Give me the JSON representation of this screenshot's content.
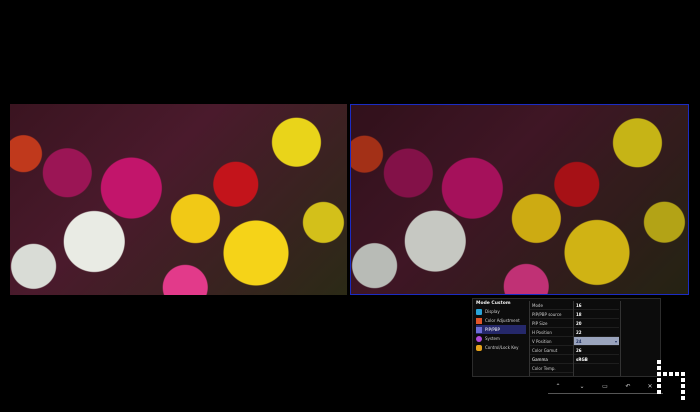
{
  "osd": {
    "title": "Mode Custom",
    "menu": [
      {
        "label": "Display",
        "icon": "display-icon",
        "color": "#2aa3d8"
      },
      {
        "label": "Color Adjustment",
        "icon": "color-adjustment-icon",
        "color": "#e0552a"
      },
      {
        "label": "PIP/PBP",
        "icon": "pip-pbp-icon",
        "color": "#6b6cd6"
      },
      {
        "label": "System",
        "icon": "system-icon",
        "color": "#b04bd8"
      },
      {
        "label": "Control/Lock Key",
        "icon": "lock-key-icon",
        "color": "#e6a21a"
      }
    ],
    "selected_menu": 2,
    "settings": [
      "Mode",
      "PIP/PBP source",
      "PIP Size",
      "H Position",
      "V Position",
      "Color Gamut",
      "Gamma",
      "Color Temp."
    ],
    "values": [
      "16",
      "18",
      "20",
      "22",
      "24",
      "26",
      "sRGB"
    ],
    "active_value_index": 4,
    "selected_setting_index": 6
  },
  "buttons": [
    "up-icon",
    "down-icon",
    "enter-icon",
    "return-icon",
    "close-icon"
  ],
  "colors": {
    "accent": "#25286a",
    "highlight": "#9aa4bd",
    "pane_border": "#1b2cc4"
  }
}
